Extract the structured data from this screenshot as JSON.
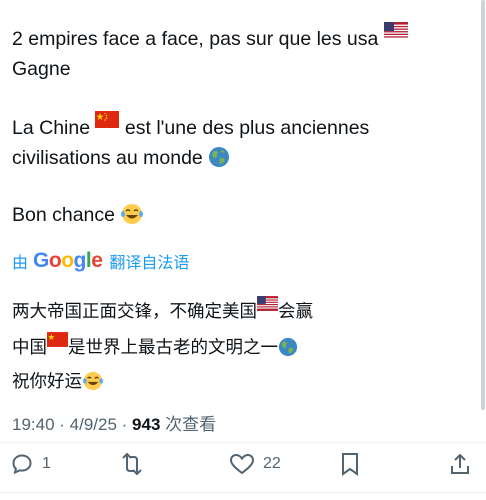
{
  "post": {
    "line1": "2 empires face a face, pas sur que les usa",
    "line2": "Gagne",
    "line3": "La Chine",
    "line3b": "est l'une des plus anciennes",
    "line4": "civilisations au monde",
    "line5": "Bon chance"
  },
  "translation": {
    "by": "由",
    "brand": "Google",
    "action": "翻译自法语",
    "line1a": "两大帝国正面交锋，不确定美国",
    "line1b": "会赢",
    "line2a": "中国",
    "line2b": "是世界上最古老的文明之一",
    "line3": "祝你好运"
  },
  "meta": {
    "time": "19:40",
    "sep": " · ",
    "date": "4/9/25",
    "views": "943",
    "views_label": "次查看"
  },
  "actions": {
    "replies": "1",
    "reposts": "",
    "likes": "22"
  },
  "icons": [
    "us-flag-icon",
    "china-flag-icon",
    "globe-icon",
    "laughing-emoji-icon",
    "reply-icon",
    "repost-icon",
    "like-icon",
    "bookmark-icon",
    "share-icon"
  ],
  "colors": {
    "link": "#1d9bf0",
    "muted": "#536471",
    "text": "#0f1419"
  }
}
